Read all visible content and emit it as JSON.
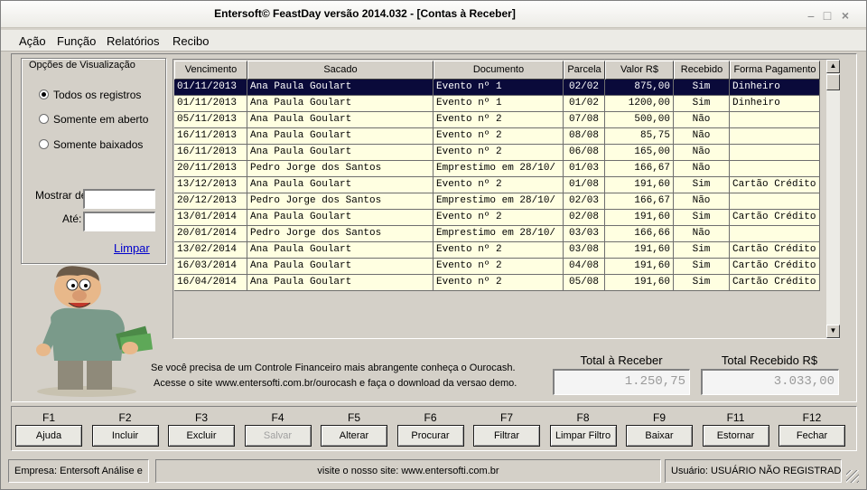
{
  "window": {
    "title": "Entersoft© FeastDay versão 2014.032 - [Contas à Receber]"
  },
  "menu": [
    "Ação",
    "Função",
    "Relatórios",
    "Recibo"
  ],
  "options": {
    "legend": "Opções de Visualização",
    "radios": [
      {
        "label": "Todos os registros",
        "checked": true
      },
      {
        "label": "Somente em aberto",
        "checked": false
      },
      {
        "label": "Somente baixados",
        "checked": false
      }
    ],
    "from_label": "Mostrar de",
    "to_label": "Até:",
    "from_value": "",
    "to_value": "",
    "clear_link": "Limpar"
  },
  "grid": {
    "columns": [
      "Vencimento",
      "Sacado",
      "Documento",
      "Parcela",
      "Valor R$",
      "Recebido",
      "Forma Pagamento"
    ],
    "rows": [
      [
        "01/11/2013",
        "Ana Paula Goulart",
        "Evento nº 1",
        "02/02",
        "875,00",
        "Sim",
        "Dinheiro"
      ],
      [
        "01/11/2013",
        "Ana Paula Goulart",
        "Evento nº 1",
        "01/02",
        "1200,00",
        "Sim",
        "Dinheiro"
      ],
      [
        "05/11/2013",
        "Ana Paula Goulart",
        "Evento nº 2",
        "07/08",
        "500,00",
        "Não",
        ""
      ],
      [
        "16/11/2013",
        "Ana Paula Goulart",
        "Evento nº 2",
        "08/08",
        "85,75",
        "Não",
        ""
      ],
      [
        "16/11/2013",
        "Ana Paula Goulart",
        "Evento nº 2",
        "06/08",
        "165,00",
        "Não",
        ""
      ],
      [
        "20/11/2013",
        "Pedro Jorge dos Santos",
        "Emprestimo em 28/10/",
        "01/03",
        "166,67",
        "Não",
        ""
      ],
      [
        "13/12/2013",
        "Ana Paula Goulart",
        "Evento nº 2",
        "01/08",
        "191,60",
        "Sim",
        "Cartão Crédito"
      ],
      [
        "20/12/2013",
        "Pedro Jorge dos Santos",
        "Emprestimo em 28/10/",
        "02/03",
        "166,67",
        "Não",
        ""
      ],
      [
        "13/01/2014",
        "Ana Paula Goulart",
        "Evento nº 2",
        "02/08",
        "191,60",
        "Sim",
        "Cartão Crédito"
      ],
      [
        "20/01/2014",
        "Pedro Jorge dos Santos",
        "Emprestimo em 28/10/",
        "03/03",
        "166,66",
        "Não",
        ""
      ],
      [
        "13/02/2014",
        "Ana Paula Goulart",
        "Evento nº 2",
        "03/08",
        "191,60",
        "Sim",
        "Cartão Crédito"
      ],
      [
        "16/03/2014",
        "Ana Paula Goulart",
        "Evento nº 2",
        "04/08",
        "191,60",
        "Sim",
        "Cartão Crédito"
      ],
      [
        "16/04/2014",
        "Ana Paula Goulart",
        "Evento nº 2",
        "05/08",
        "191,60",
        "Sim",
        "Cartão Crédito"
      ]
    ]
  },
  "promo": {
    "line1": "Se você precisa de um Controle Financeiro mais abrangente conheça o Ourocash.",
    "line2": "Acesse o site www.entersofti.com.br/ourocash e faça o download da versao demo."
  },
  "totals": {
    "receivable_label": "Total à Receber",
    "receivable_value": "1.250,75",
    "received_label": "Total Recebido R$",
    "received_value": "3.033,00"
  },
  "fkeys": [
    {
      "key": "F1",
      "label": "Ajuda",
      "enabled": true
    },
    {
      "key": "F2",
      "label": "Incluir",
      "enabled": true
    },
    {
      "key": "F3",
      "label": "Excluir",
      "enabled": true
    },
    {
      "key": "F4",
      "label": "Salvar",
      "enabled": false
    },
    {
      "key": "F5",
      "label": "Alterar",
      "enabled": true
    },
    {
      "key": "F6",
      "label": "Procurar",
      "enabled": true
    },
    {
      "key": "F7",
      "label": "Filtrar",
      "enabled": true
    },
    {
      "key": "F8",
      "label": "Limpar Filtro",
      "enabled": true
    },
    {
      "key": "F9",
      "label": "Baixar",
      "enabled": true
    },
    {
      "key": "F11",
      "label": "Estornar",
      "enabled": true
    },
    {
      "key": "F12",
      "label": "Fechar",
      "enabled": true
    }
  ],
  "status": {
    "company": "Empresa: Entersoft Análise e",
    "site": "visite o nosso site: www.entersofti.com.br",
    "user": "Usuário: USUÁRIO NÃO REGISTRADO"
  },
  "colors": {
    "selected_row": "#0a0a3a",
    "row_bg": "#ffffe1",
    "link": "#0000cc"
  }
}
